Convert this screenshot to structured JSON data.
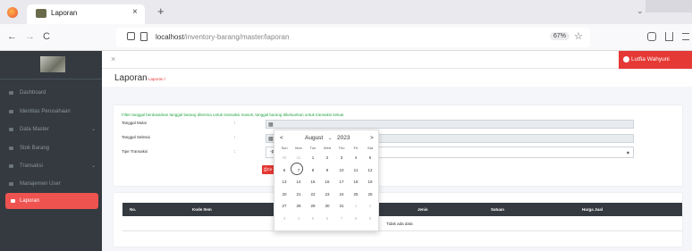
{
  "browser": {
    "tab_title": "Laporan",
    "tab_close": "×",
    "new_tab": "+",
    "tab_list": "⌄",
    "nav_back": "←",
    "nav_forward": "→",
    "nav_reload": "C",
    "url_host": "localhost",
    "url_path": "/inventory-barang/master/laporan",
    "zoom": "67%",
    "bookmark_star": "☆"
  },
  "sidebar": {
    "items": [
      {
        "label": "Dashboard"
      },
      {
        "label": "Identitas Perusahaan"
      },
      {
        "label": "Data Master"
      },
      {
        "label": "Stok Barang"
      },
      {
        "label": "Transaksi"
      },
      {
        "label": "Manajemen User"
      },
      {
        "label": "Laporan"
      }
    ]
  },
  "topbar": {
    "menu_toggle": "×",
    "user_name": "Lutfia Wahyuni"
  },
  "page": {
    "title": "Laporan",
    "breadcrumb": "Laporan /"
  },
  "filter": {
    "note": "Filter tanggal berdasarkan tanggal barang diterima untuk transaksi masuk, tanggal barang dikeluarkan untuk transaksi keluar",
    "label_start": "Tanggal Mulai",
    "label_end": "Tanggal Selesai",
    "label_type": "Tipe Transaksi",
    "colon": ":",
    "type_value": "-pi",
    "cetak_label": "Ce"
  },
  "datepicker": {
    "prev": "<",
    "next": ">",
    "month": "August",
    "year": "2023",
    "weekdays": [
      "Sun",
      "Mon",
      "Tue",
      "Wed",
      "Thu",
      "Fri",
      "Sat"
    ],
    "weeks": [
      [
        "30",
        "31",
        "1",
        "2",
        "3",
        "4",
        "5"
      ],
      [
        "6",
        "7",
        "8",
        "9",
        "10",
        "11",
        "12"
      ],
      [
        "13",
        "14",
        "15",
        "16",
        "17",
        "18",
        "19"
      ],
      [
        "20",
        "21",
        "22",
        "23",
        "24",
        "25",
        "26"
      ],
      [
        "27",
        "28",
        "29",
        "30",
        "31",
        "1",
        "2"
      ],
      [
        "3",
        "4",
        "5",
        "6",
        "7",
        "8",
        "9"
      ]
    ],
    "selected": "7"
  },
  "table": {
    "headers": [
      "No.",
      "Kode Item",
      "Jenis",
      "Satuan",
      "Harga Jual"
    ],
    "empty": "Tidak ada data"
  }
}
